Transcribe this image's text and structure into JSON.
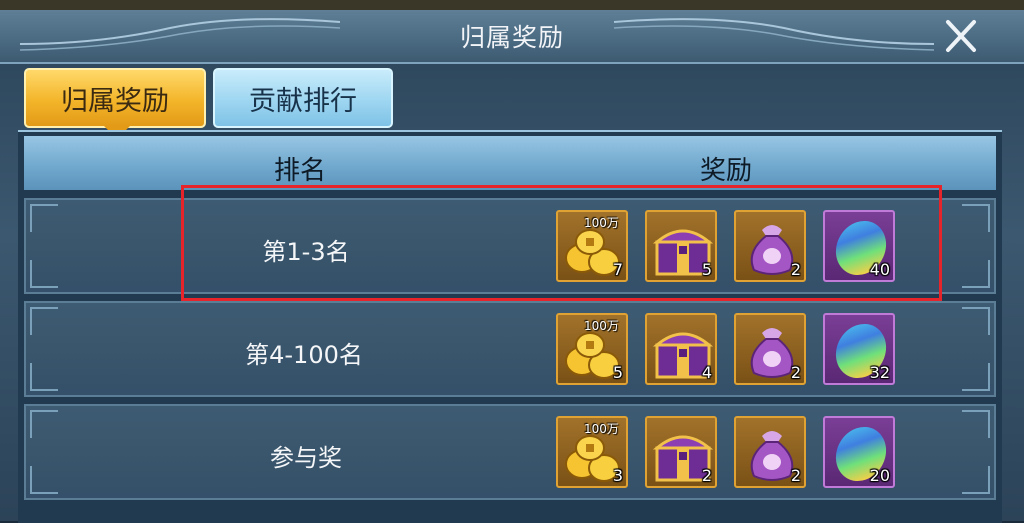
{
  "window": {
    "title": "归属奖励"
  },
  "tabs": [
    {
      "label": "归属奖励",
      "active": true
    },
    {
      "label": "贡献排行",
      "active": false
    }
  ],
  "table": {
    "headers": {
      "rank": "排名",
      "reward": "奖励"
    },
    "rows": [
      {
        "rank": "第1-3名",
        "rewards": {
          "coins": {
            "tag": "100万",
            "count": "7"
          },
          "chest": {
            "count": "5"
          },
          "bag": {
            "count": "2"
          },
          "gem": {
            "count": "40"
          }
        }
      },
      {
        "rank": "第4-100名",
        "rewards": {
          "coins": {
            "tag": "100万",
            "count": "5"
          },
          "chest": {
            "count": "4"
          },
          "bag": {
            "count": "2"
          },
          "gem": {
            "count": "32"
          }
        }
      },
      {
        "rank": "参与奖",
        "rewards": {
          "coins": {
            "tag": "100万",
            "count": "3"
          },
          "chest": {
            "count": "2"
          },
          "bag": {
            "count": "2"
          },
          "gem": {
            "count": "20"
          }
        }
      }
    ]
  },
  "icons": {
    "close": "close-icon",
    "coins": "gold-coins-icon",
    "chest": "treasure-chest-icon",
    "bag": "soul-bag-icon",
    "gem": "rainbow-gem-icon"
  },
  "colors": {
    "tab_active": "#f3b52a",
    "tab_inactive": "#9ed6f1",
    "highlight": "#e8242b",
    "gold_frame": "#e0a233",
    "purple_frame": "#c07ad8"
  }
}
